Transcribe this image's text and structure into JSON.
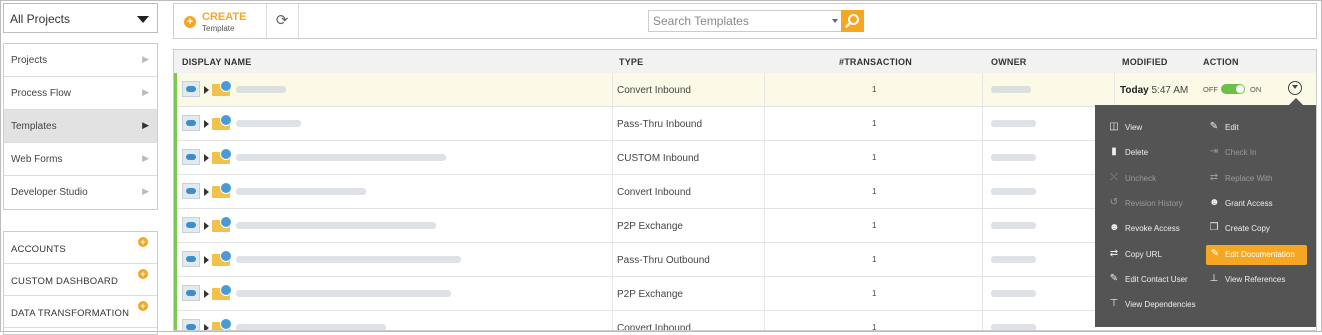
{
  "sidebar": {
    "project_select": "All Projects",
    "nav": [
      {
        "label": "Projects"
      },
      {
        "label": "Process Flow"
      },
      {
        "label": "Templates"
      },
      {
        "label": "Web Forms"
      },
      {
        "label": "Developer Studio"
      }
    ],
    "sections": [
      {
        "label": "ACCOUNTS"
      },
      {
        "label": "CUSTOM DASHBOARD"
      },
      {
        "label": "DATA TRANSFORMATION"
      }
    ]
  },
  "toolbar": {
    "create_label": "CREATE",
    "create_sub": "Template",
    "search_placeholder": "Search Templates"
  },
  "table": {
    "headers": {
      "display_name": "DISPLAY NAME",
      "type": "TYPE",
      "transaction": "#TRANSACTION",
      "owner": "OWNER",
      "modified": "MODIFIED",
      "action": "ACTION"
    },
    "rows": [
      {
        "type": "Convert Inbound",
        "transaction": "1",
        "modified_bold": "Today",
        "modified_time": "5:47 AM",
        "toggle_off": "OFF",
        "toggle_on": "ON"
      },
      {
        "type": "Pass-Thru Inbound",
        "transaction": "1"
      },
      {
        "type": "CUSTOM Inbound",
        "transaction": "1"
      },
      {
        "type": "Convert Inbound",
        "transaction": "1"
      },
      {
        "type": "P2P Exchange",
        "transaction": "1"
      },
      {
        "type": "Pass-Thru Outbound",
        "transaction": "1"
      },
      {
        "type": "P2P Exchange",
        "transaction": "1"
      },
      {
        "type": "Convert Inbound",
        "transaction": "1"
      }
    ]
  },
  "menu": {
    "view": "View",
    "edit": "Edit",
    "delete": "Delete",
    "check_in": "Check In",
    "uncheck": "Uncheck",
    "replace_with": "Replace With",
    "revision_history": "Revision History",
    "grant_access": "Grant Access",
    "revoke_access": "Revoke Access",
    "create_copy": "Create Copy",
    "copy_url": "Copy URL",
    "edit_documentation": "Edit Documentation",
    "edit_contact_user": "Edit Contact User",
    "view_references": "View References",
    "view_dependencies": "View Dependencies"
  },
  "colors": {
    "accent": "#f5a623",
    "toggle_on": "#6cc04a",
    "row_indicator": "#7dc855",
    "menu_bg": "#545454",
    "highlight_row": "#fbfae6"
  }
}
